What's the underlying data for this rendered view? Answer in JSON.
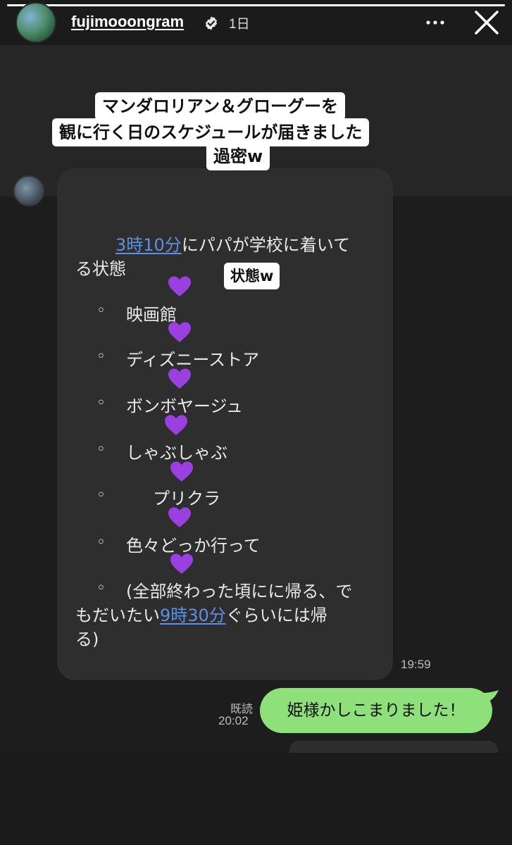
{
  "header": {
    "username": "fujimooongram",
    "time_ago": "1日"
  },
  "caption": {
    "line1": "マンダロリアン＆グローグーを",
    "line2": "観に行く日のスケジュールが届きました",
    "line3": "過密w"
  },
  "sticker_small": "状態w",
  "message": {
    "line1_pre": "3時10分",
    "line1_post": "にパパが学校に着いて",
    "line2": "る状態",
    "items": [
      "映画館",
      "ディズニーストア",
      "ボンボヤージュ",
      "しゃぶしゃぶ",
      "プリクラ",
      "色々どっか行って",
      "(全部終わった頃にに帰る、で"
    ],
    "last_line_pre": "もだいたい",
    "last_line_link": "9時30分",
    "last_line_post": "ぐらいには帰",
    "last_line2": "る)",
    "bullet": "◦",
    "time": "19:59"
  },
  "reply": {
    "read_label": "既読",
    "time": "20:02",
    "text": "姫様かしこまりました！"
  },
  "colors": {
    "link": "#5c8fe6",
    "green_bubble": "#8de07a",
    "heart": "#9b3fe0"
  },
  "icons": [
    "verified-badge-icon",
    "more-options-icon",
    "close-icon",
    "purple-heart-icon"
  ]
}
